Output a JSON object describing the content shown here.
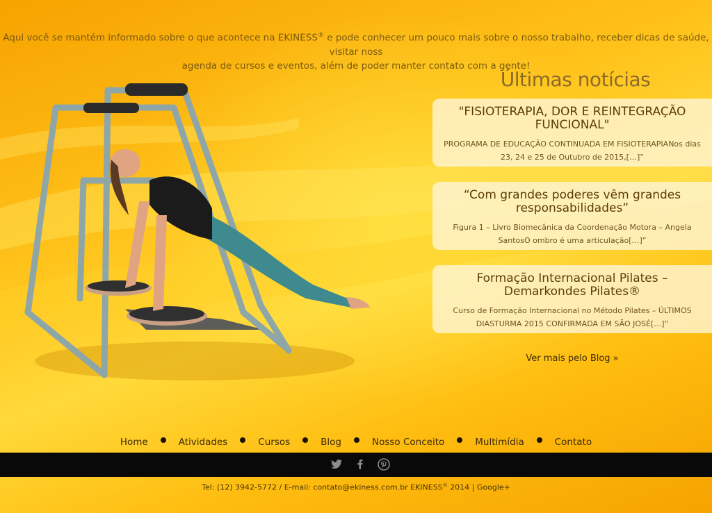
{
  "intro": {
    "line1_before": "Aqui você se mantém informado sobre o que acontece na EKINESS",
    "reg": "®",
    "line1_after": " e pode conhecer um pouco mais sobre o nosso trabalho, receber dicas de saúde, visitar noss",
    "line2": "agenda de cursos e eventos, além de poder manter contato com a gente!"
  },
  "news": {
    "title": "Últimas notícias",
    "items": [
      {
        "title": "\"FISIOTERAPIA, DOR E REINTEGRAÇÃO FUNCIONAL\"",
        "excerpt": "PROGRAMA DE EDUCAÇÃO CONTINUADA EM FISIOTERAPIANos dias 23, 24 e 25 de Outubro de 2015,[…]”"
      },
      {
        "title": "“Com grandes poderes vêm grandes responsabilidades”",
        "excerpt": "Figura 1 – Livro Biomecânica da Coordenação Motora – Angela SantosO ombro é uma articulação[…]”"
      },
      {
        "title": "Formação Internacional Pilates – Demarkondes Pilates®",
        "excerpt": "Curso de Formação Internacional no Método Pilates – ÚLTIMOS DIASTURMA 2015 CONFIRMADA EM SÃO JOSÉ[…]”"
      }
    ],
    "more_link": "Ver mais pelo Blog »"
  },
  "nav": [
    "Home",
    "Atividades",
    "Cursos",
    "Blog",
    "Nosso Conceito",
    "Multimídia",
    "Contato"
  ],
  "social": [
    "twitter-icon",
    "facebook-icon",
    "pinterest-icon"
  ],
  "footer": {
    "before": "Tel: (12) 3942-5772 / E-mail: contato@ekiness.com.br EKINESS",
    "reg": "®",
    "after": " 2014 | Google+"
  },
  "colors": {
    "social_bar": "#090909",
    "card_bg": "#fff4d2",
    "text_dark": "#3d2c06"
  }
}
